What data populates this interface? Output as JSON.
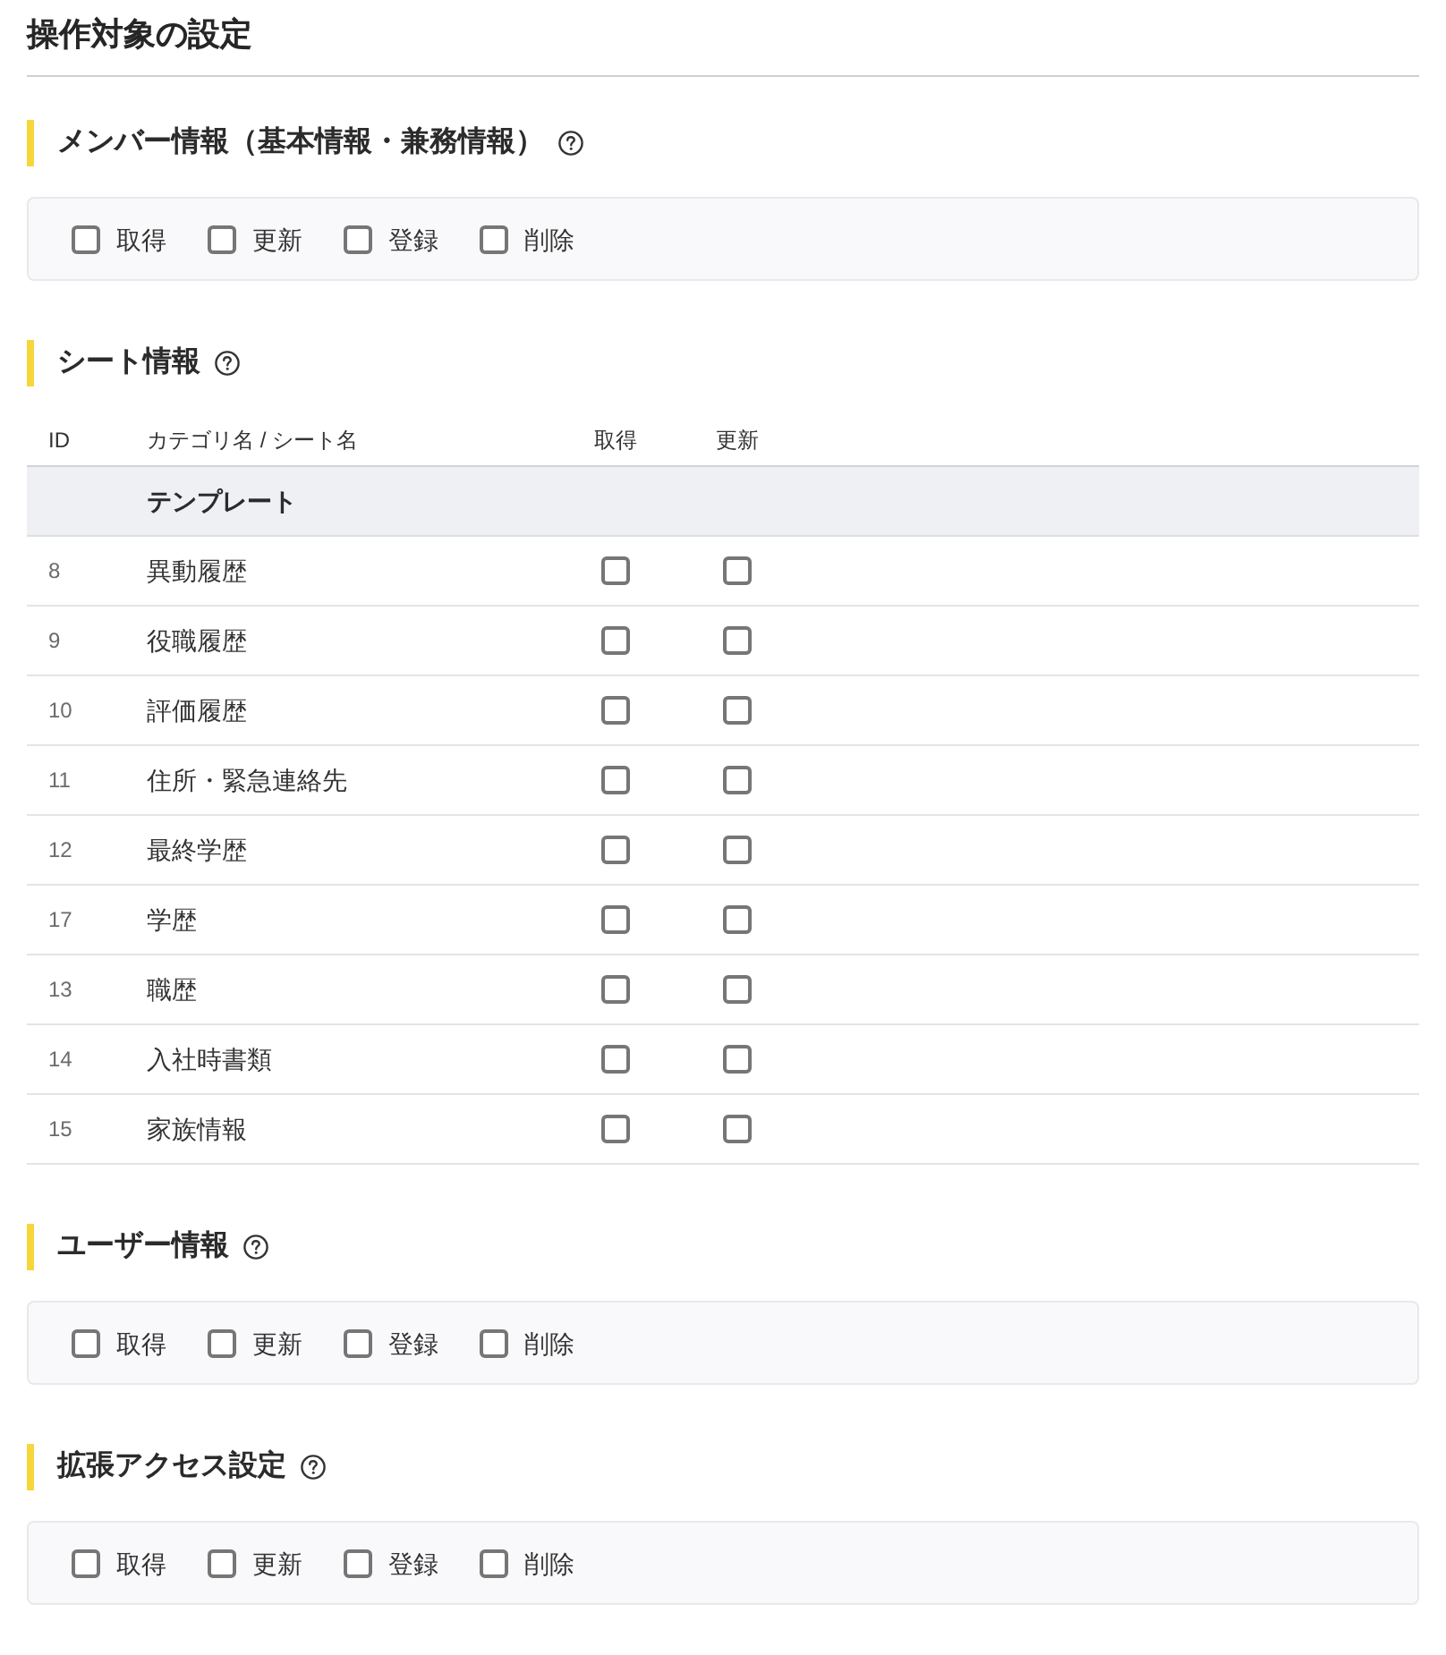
{
  "page": {
    "title": "操作対象の設定"
  },
  "sections": [
    {
      "kind": "checkbox_panel",
      "title": "メンバー情報（基本情報・兼務情報）",
      "options": [
        {
          "label": "取得",
          "checked": false
        },
        {
          "label": "更新",
          "checked": false
        },
        {
          "label": "登録",
          "checked": false
        },
        {
          "label": "削除",
          "checked": false
        }
      ]
    },
    {
      "kind": "table",
      "title": "シート情報",
      "table": {
        "columns": [
          "ID",
          "カテゴリ名 / シート名",
          "取得",
          "更新"
        ],
        "groups": [
          {
            "label": "テンプレート",
            "rows": [
              {
                "id": "8",
                "name": "異動履歴",
                "checks": [
                  {
                    "checked": false
                  },
                  {
                    "checked": false
                  }
                ]
              },
              {
                "id": "9",
                "name": "役職履歴",
                "checks": [
                  {
                    "checked": false
                  },
                  {
                    "checked": false
                  }
                ]
              },
              {
                "id": "10",
                "name": "評価履歴",
                "checks": [
                  {
                    "checked": false
                  },
                  {
                    "checked": false
                  }
                ]
              },
              {
                "id": "11",
                "name": "住所・緊急連絡先",
                "checks": [
                  {
                    "checked": false
                  },
                  {
                    "checked": false
                  }
                ]
              },
              {
                "id": "12",
                "name": "最終学歴",
                "checks": [
                  {
                    "checked": false
                  },
                  {
                    "checked": false
                  }
                ]
              },
              {
                "id": "17",
                "name": "学歴",
                "checks": [
                  {
                    "checked": false
                  },
                  {
                    "checked": false
                  }
                ]
              },
              {
                "id": "13",
                "name": "職歴",
                "checks": [
                  {
                    "checked": false
                  },
                  {
                    "checked": false
                  }
                ]
              },
              {
                "id": "14",
                "name": "入社時書類",
                "checks": [
                  {
                    "checked": false
                  },
                  {
                    "checked": false
                  }
                ]
              },
              {
                "id": "15",
                "name": "家族情報",
                "checks": [
                  {
                    "checked": false
                  },
                  {
                    "checked": false
                  }
                ]
              }
            ]
          }
        ]
      }
    },
    {
      "kind": "checkbox_panel",
      "title": "ユーザー情報",
      "options": [
        {
          "label": "取得",
          "checked": false
        },
        {
          "label": "更新",
          "checked": false
        },
        {
          "label": "登録",
          "checked": false
        },
        {
          "label": "削除",
          "checked": false
        }
      ]
    },
    {
      "kind": "checkbox_panel",
      "title": "拡張アクセス設定",
      "options": [
        {
          "label": "取得",
          "checked": false
        },
        {
          "label": "更新",
          "checked": false
        },
        {
          "label": "登録",
          "checked": false
        },
        {
          "label": "削除",
          "checked": false
        }
      ]
    }
  ]
}
